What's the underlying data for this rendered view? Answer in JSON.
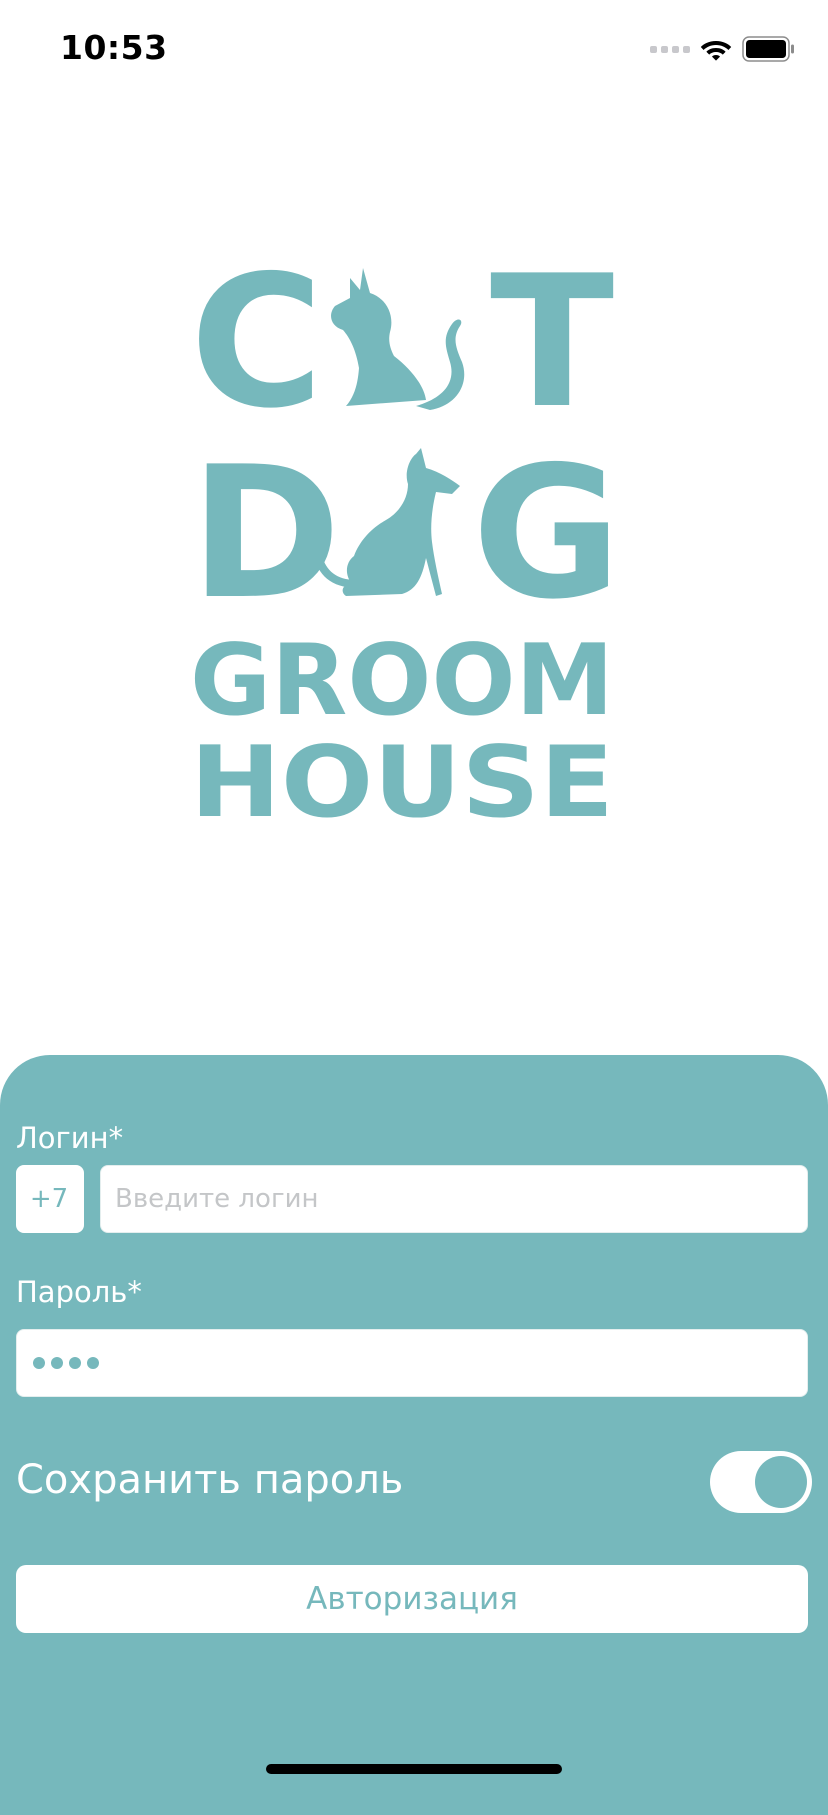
{
  "status_bar": {
    "time": "10:53",
    "icons": [
      "signal-dots",
      "wifi-icon",
      "battery-icon"
    ]
  },
  "logo": {
    "line1": [
      "C",
      "T"
    ],
    "line2": [
      "D",
      "G"
    ],
    "line3": "GROOM",
    "line4": "HOUSE",
    "icons": [
      "cat-silhouette",
      "dog-silhouette"
    ]
  },
  "form": {
    "login_label": "Логин*",
    "phone_prefix": "+7",
    "login_placeholder": "Введите логин",
    "login_value": "",
    "password_label": "Пароль*",
    "password_masked_length": 4,
    "save_password_label": "Сохранить пароль",
    "save_password_enabled": true,
    "submit_label": "Авторизация"
  },
  "colors": {
    "brand": "#76b8bc",
    "background": "#ffffff",
    "text_on_brand": "#ffffff"
  }
}
